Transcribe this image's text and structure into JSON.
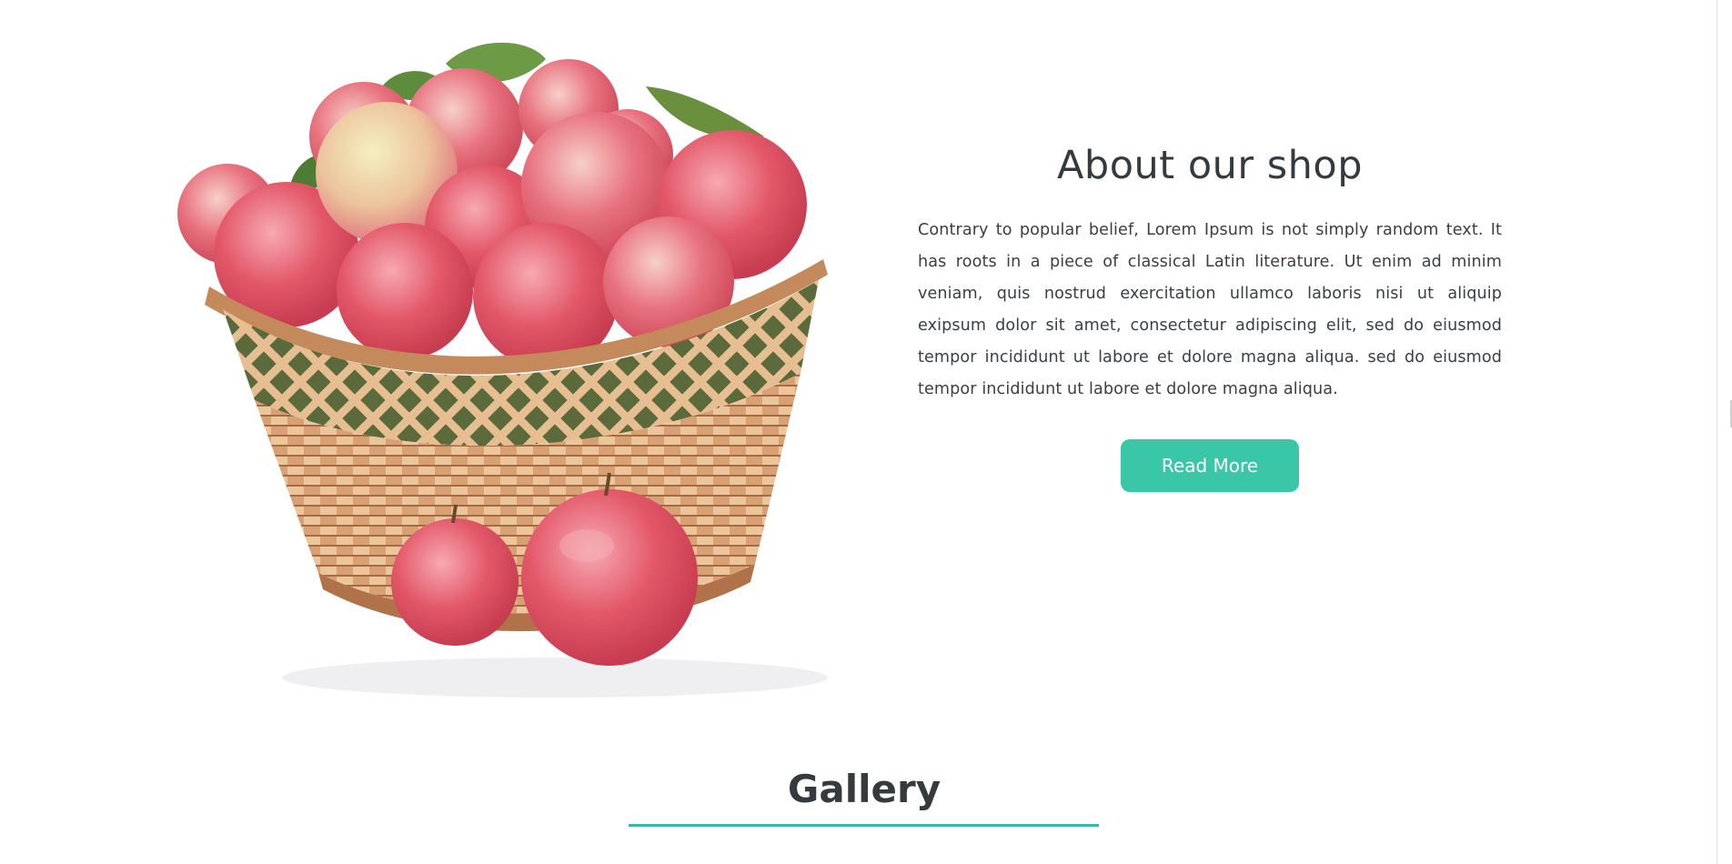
{
  "about": {
    "title": "About our shop",
    "body": "Contrary to popular belief, Lorem Ipsum is not simply random text. It has roots in a piece of classical Latin literature. Ut enim ad minim veniam, quis nostrud exercitation ullamco laboris nisi ut aliquip exipsum dolor sit amet, consectetur adipiscing elit, sed do eiusmod tempor incididunt ut labore et dolore magna aliqua. sed do eiusmod tempor incididunt ut labore et dolore magna aliqua.",
    "button_label": "Read More"
  },
  "gallery": {
    "title": "Gallery"
  },
  "colors": {
    "accent": "#3ac7a7",
    "heading": "#333b3f",
    "underline": "#3ab8a3"
  }
}
